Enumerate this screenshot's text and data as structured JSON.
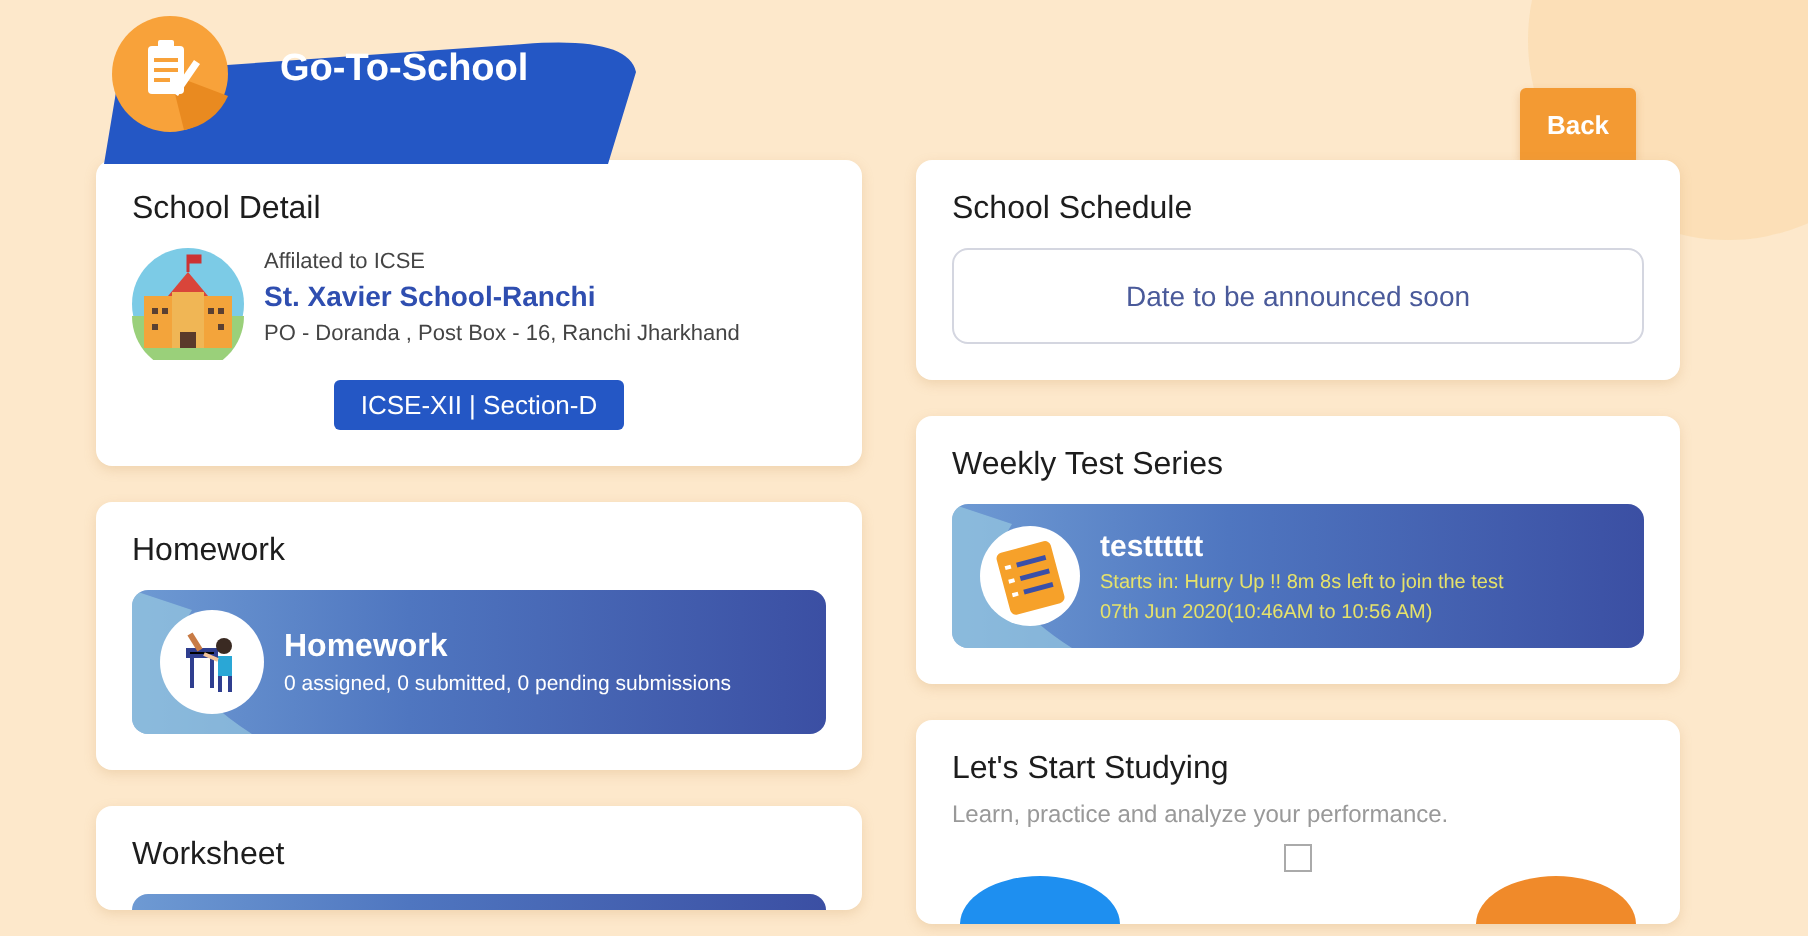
{
  "header": {
    "title": "Go-To-School"
  },
  "back_button": {
    "label": "Back"
  },
  "school_detail": {
    "title": "School Detail",
    "affiliation": "Affilated to ICSE",
    "school_name": "St. Xavier School-Ranchi",
    "address": "PO - Doranda , Post Box - 16, Ranchi Jharkhand",
    "class_badge": "ICSE-XII | Section-D"
  },
  "homework": {
    "title": "Homework",
    "banner_title": "Homework",
    "summary": "0 assigned, 0 submitted, 0 pending submissions"
  },
  "worksheet": {
    "title": "Worksheet"
  },
  "school_schedule": {
    "title": "School Schedule",
    "message": "Date to be announced soon"
  },
  "weekly_test_series": {
    "title": "Weekly Test Series",
    "test_name": "testttttt",
    "starts_in": "Starts in: Hurry Up !! 8m 8s left to join the test",
    "time": "07th Jun 2020(10:46AM to 10:56 AM)"
  },
  "study": {
    "title": "Let's Start Studying",
    "subtitle": "Learn, practice and analyze your performance."
  }
}
